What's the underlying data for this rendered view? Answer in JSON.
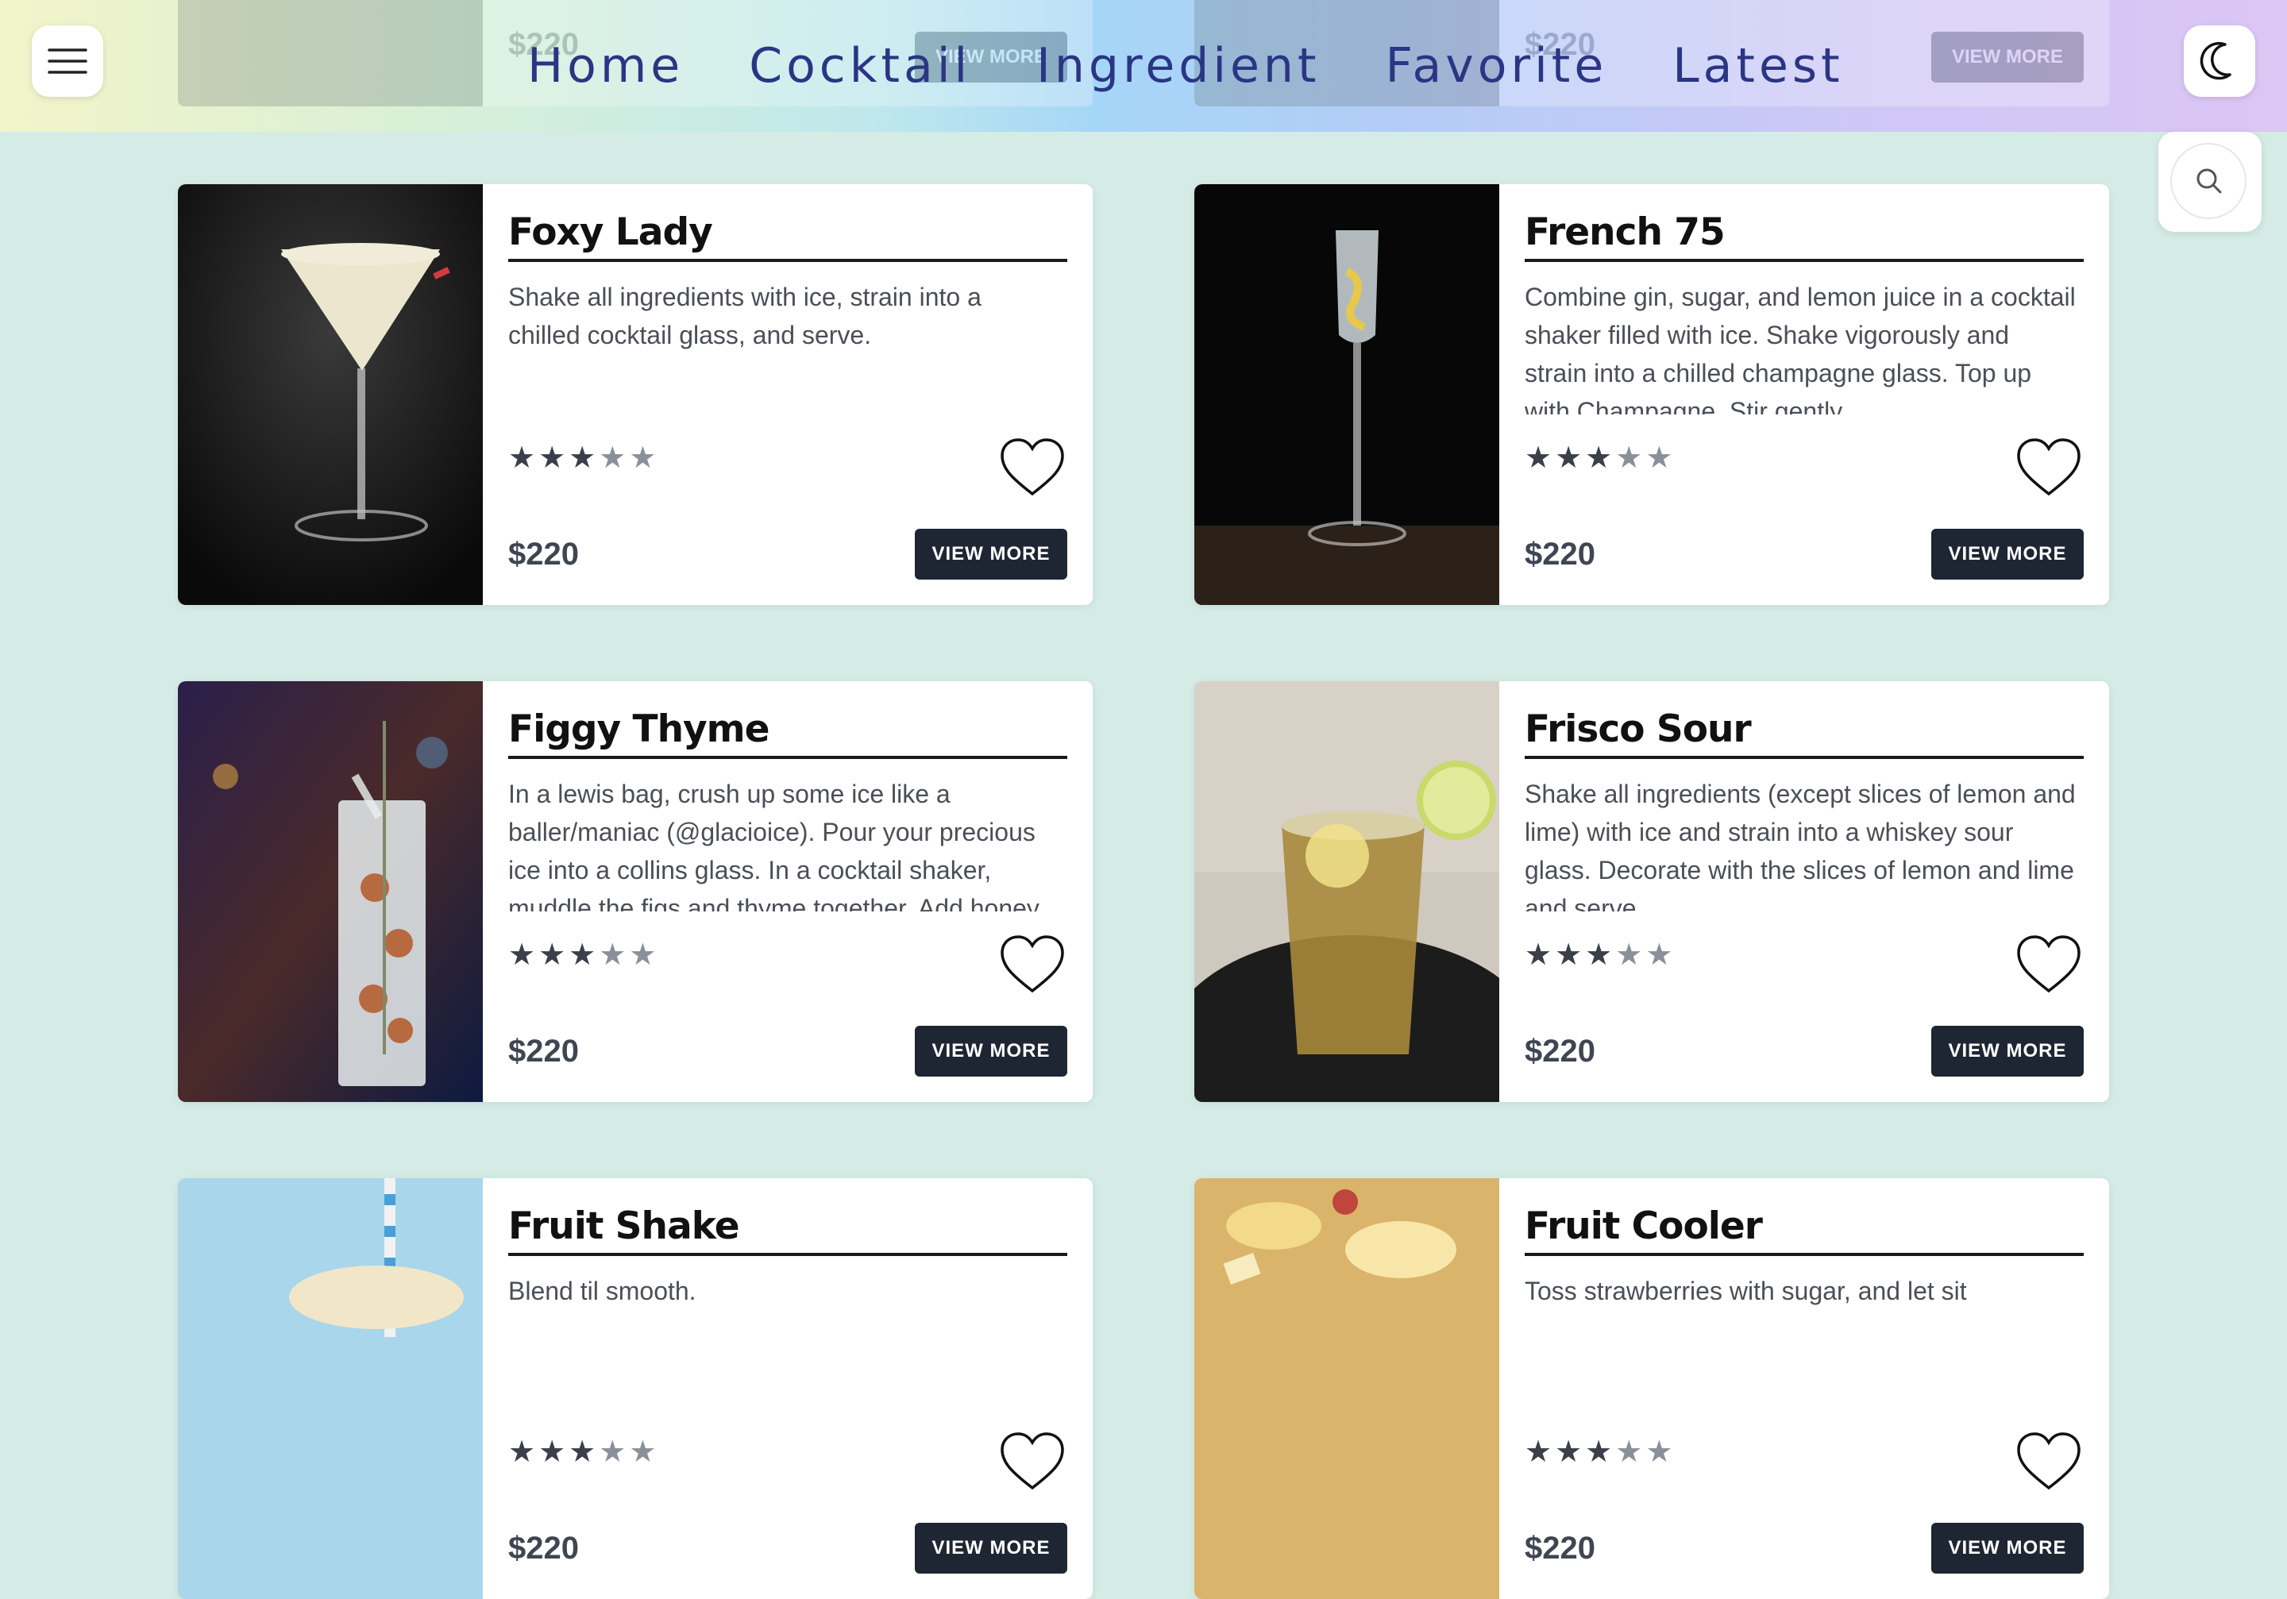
{
  "nav": {
    "links": [
      "Home",
      "Cocktail",
      "Ingredient",
      "Favorite",
      "Latest"
    ]
  },
  "behind_nav": {
    "left_price": "$220",
    "right_price": "$220",
    "button_label": "VIEW MORE"
  },
  "icons": {
    "menu": "hamburger-menu-icon",
    "theme": "crescent-moon-icon",
    "search": "magnifier-search-icon",
    "favorite": "heart-outline-icon",
    "rating": "star-icon"
  },
  "colors": {
    "page_background": "#d5ece6",
    "nav_text": "#2a3584",
    "button_background": "#1e2633",
    "star_filled": "#3a3f4a",
    "star_empty": "#8a909a"
  },
  "cards": [
    {
      "title": "Foxy Lady",
      "description": "Shake all ingredients with ice, strain into a chilled cocktail glass, and serve.",
      "rating": 3,
      "rating_max": 5,
      "price": "$220",
      "button_label": "VIEW MORE"
    },
    {
      "title": "French 75",
      "description": "Combine gin, sugar, and lemon juice in a cocktail shaker filled with ice. Shake vigorously and strain into a chilled champagne glass. Top up with Champagne. Stir gently.",
      "rating": 3,
      "rating_max": 5,
      "price": "$220",
      "button_label": "VIEW MORE"
    },
    {
      "title": "Figgy Thyme",
      "description": "In a lewis bag, crush up some ice like a baller/maniac (@glacioice). Pour your precious ice into a collins glass. In a cocktail shaker, muddle the figs and thyme together. Add honey",
      "rating": 3,
      "rating_max": 5,
      "price": "$220",
      "button_label": "VIEW MORE"
    },
    {
      "title": "Frisco Sour",
      "description": "Shake all ingredients (except slices of lemon and lime) with ice and strain into a whiskey sour glass. Decorate with the slices of lemon and lime and serve.",
      "rating": 3,
      "rating_max": 5,
      "price": "$220",
      "button_label": "VIEW MORE"
    },
    {
      "title": "Fruit Shake",
      "description": "Blend til smooth.",
      "rating": 3,
      "rating_max": 5,
      "price": "$220",
      "button_label": "VIEW MORE"
    },
    {
      "title": "Fruit Cooler",
      "description": "Toss strawberries with sugar, and let sit",
      "rating": 3,
      "rating_max": 5,
      "price": "$220",
      "button_label": "VIEW MORE"
    }
  ]
}
